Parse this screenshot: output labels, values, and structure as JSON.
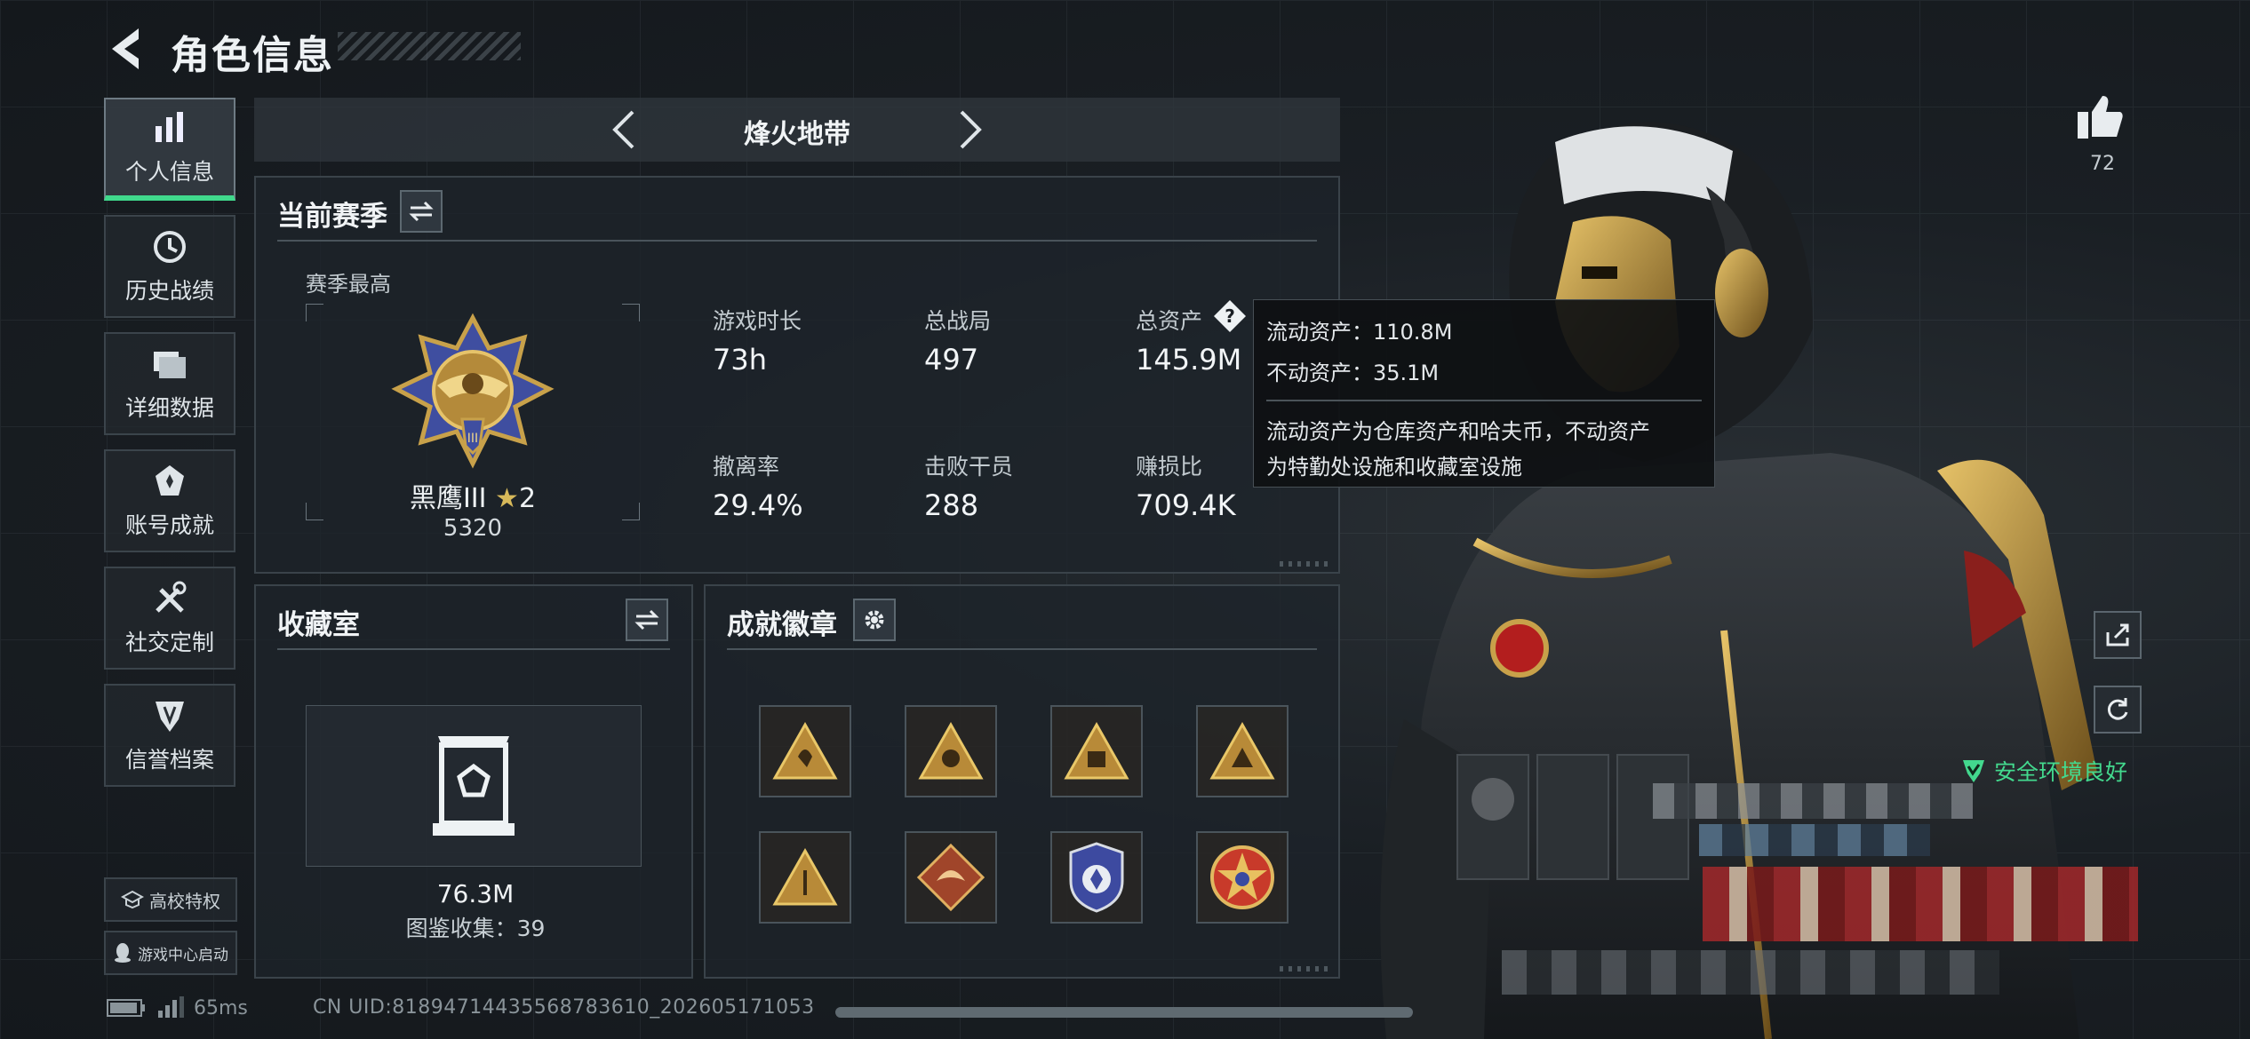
{
  "header": {
    "title": "角色信息"
  },
  "nav": {
    "items": [
      {
        "label": "个人信息",
        "icon": "bar-chart-icon",
        "active": true
      },
      {
        "label": "历史战绩",
        "icon": "clock-icon"
      },
      {
        "label": "详细数据",
        "icon": "folder-icon"
      },
      {
        "label": "账号成就",
        "icon": "achievement-icon"
      },
      {
        "label": "社交定制",
        "icon": "tools-icon"
      },
      {
        "label": "信誉档案",
        "icon": "shield-icon"
      }
    ],
    "school_label": "高校特权",
    "game_center_label": "游戏中心启动"
  },
  "mode": {
    "label": "烽火地带"
  },
  "season": {
    "title": "当前赛季",
    "best_label": "赛季最高",
    "rank_name": "黑鹰III",
    "rank_stars": "2",
    "rank_score": "5320",
    "stats": [
      {
        "label": "游戏时长",
        "value": "73h"
      },
      {
        "label": "总战局",
        "value": "497"
      },
      {
        "label": "总资产",
        "value": "145.9M"
      },
      {
        "label": "撤离率",
        "value": "29.4%"
      },
      {
        "label": "击败干员",
        "value": "288"
      },
      {
        "label": "赚损比",
        "value": "709.4K"
      }
    ]
  },
  "tooltip": {
    "liquid": "流动资产：110.8M",
    "fixed": "不动资产：35.1M",
    "desc_line1": "流动资产为仓库资产和哈夫币，不动资产",
    "desc_line2": "为特勤处设施和收藏室设施"
  },
  "collection": {
    "title": "收藏室",
    "value": "76.3M",
    "count_label": "图鉴收集：39"
  },
  "badges": {
    "title": "成就徽章",
    "items": [
      "triangle-badge-icon",
      "triangle-badge-icon",
      "triangle-badge-icon",
      "triangle-badge-icon",
      "triangle-badge-icon",
      "dragon-badge-icon",
      "police-badge-icon",
      "star-badge-icon"
    ]
  },
  "profile": {
    "like_count": "72",
    "safe_env": "安全环境良好"
  },
  "footer": {
    "ping": "65ms",
    "uid": "CN UID:8189471443556878361​0_202605171053"
  },
  "colors": {
    "accent": "#40d98c",
    "gold": "#c8a14a",
    "panel_border": "#3a434a"
  }
}
